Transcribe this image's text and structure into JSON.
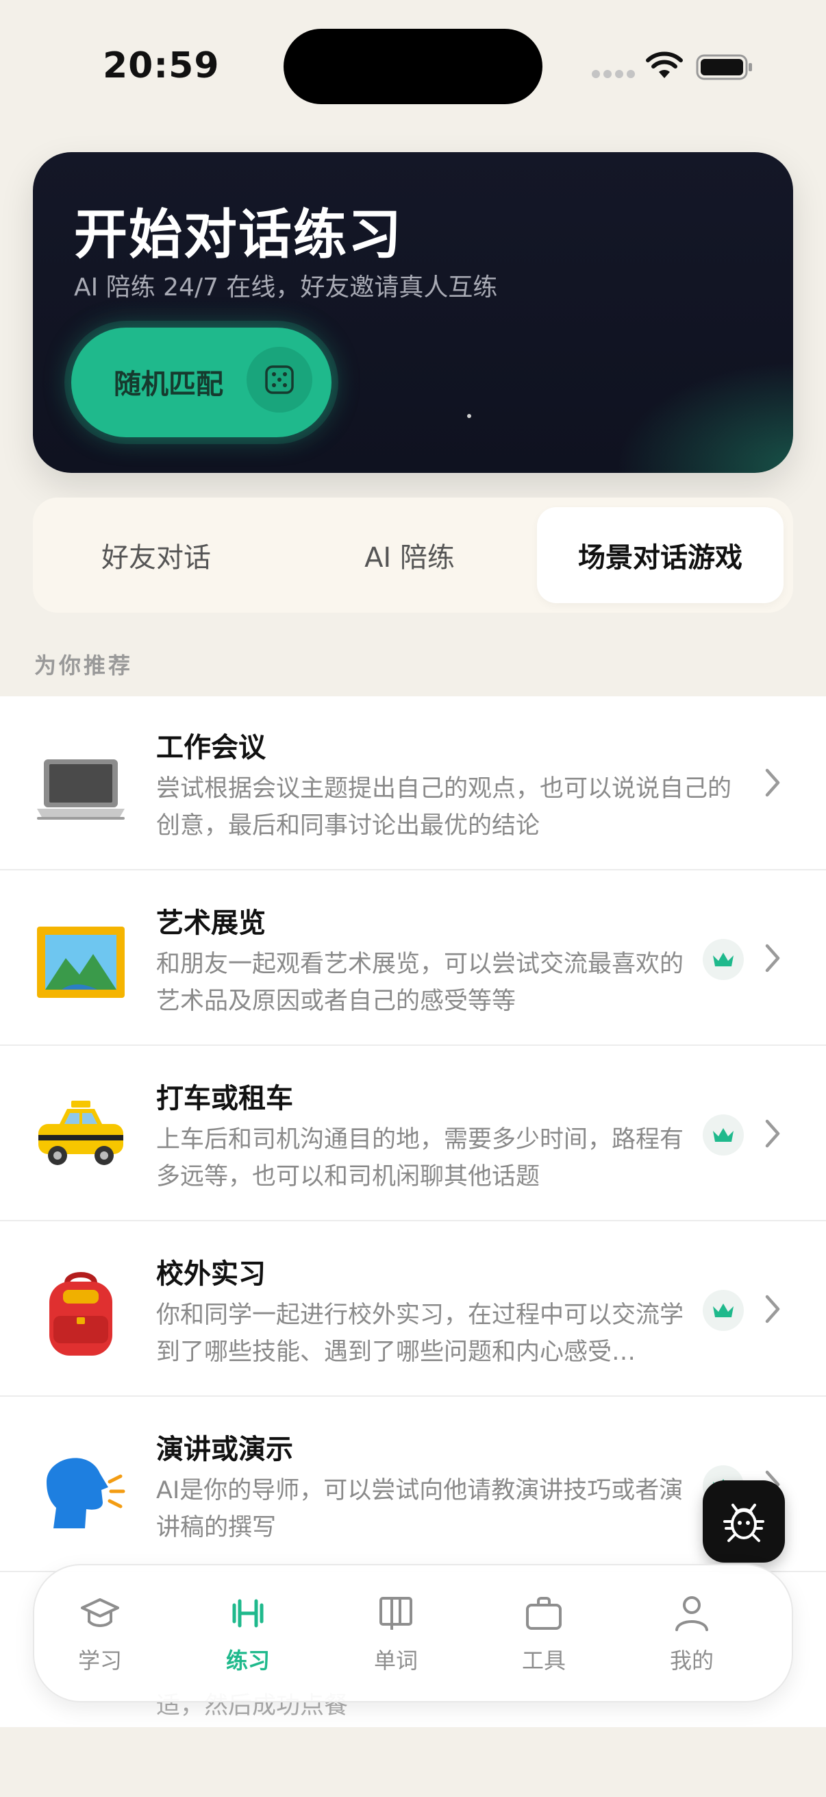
{
  "status_bar": {
    "time": "20:59"
  },
  "hero": {
    "title": "开始对话练习",
    "subtitle": "AI 陪练 24/7 在线，好友邀请真人互练",
    "match_button": "随机匹配"
  },
  "tabs": [
    {
      "label": "好友对话",
      "active": false
    },
    {
      "label": "AI 陪练",
      "active": false
    },
    {
      "label": "场景对话游戏",
      "active": true
    }
  ],
  "section_label": "为你推荐",
  "scenarios": [
    {
      "title": "工作会议",
      "description": "尝试根据会议主题提出自己的观点，也可以说说自己的创意，最后和同事讨论出最优的结论",
      "icon": "laptop-icon",
      "premium": false
    },
    {
      "title": "艺术展览",
      "description": "和朋友一起观看艺术展览，可以尝试交流最喜欢的艺术品及原因或者自己的感受等等",
      "icon": "framed-picture-icon",
      "premium": true
    },
    {
      "title": "打车或租车",
      "description": "上车后和司机沟通目的地，需要多少时间，路程有多远等，也可以和司机闲聊其他话题",
      "icon": "taxi-icon",
      "premium": true
    },
    {
      "title": "校外实习",
      "description": "你和同学一起进行校外实习，在过程中可以交流学到了哪些技能、遇到了哪些问题和内心感受…",
      "icon": "backpack-icon",
      "premium": true
    },
    {
      "title": "演讲或演示",
      "description": "AI是你的导师，可以尝试向他请教演讲技巧或者演讲稿的撰写",
      "icon": "speaking-head-icon",
      "premium": true
    }
  ],
  "peek_text": "适，然后成功点餐",
  "bottom_nav": [
    {
      "label": "学习",
      "icon": "graduation-cap-icon",
      "active": false
    },
    {
      "label": "练习",
      "icon": "dumbbell-icon",
      "active": true
    },
    {
      "label": "单词",
      "icon": "book-icon",
      "active": false
    },
    {
      "label": "工具",
      "icon": "briefcase-icon",
      "active": false
    },
    {
      "label": "我的",
      "icon": "person-icon",
      "active": false
    }
  ],
  "colors": {
    "accent": "#1fb98c",
    "hero_bg": "#141727",
    "page_bg": "#f3f0e9"
  }
}
